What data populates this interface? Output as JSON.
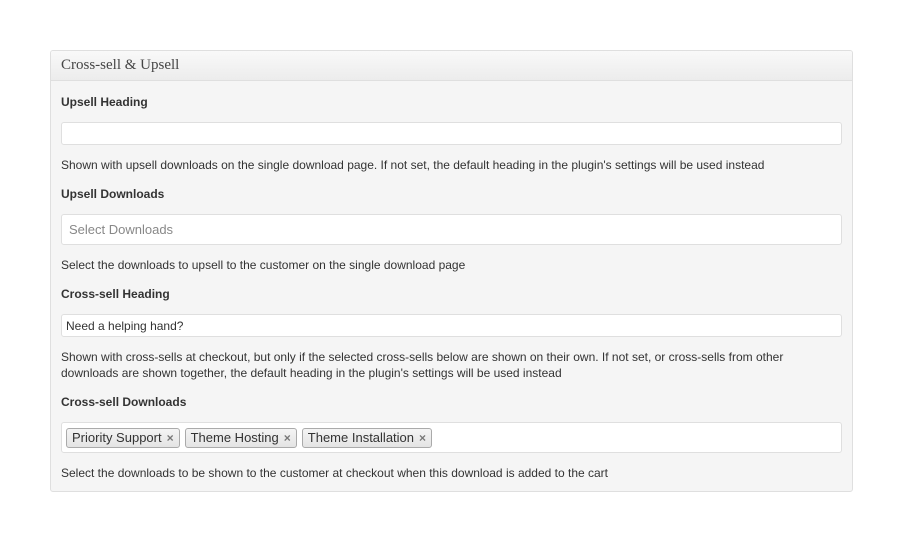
{
  "metabox": {
    "title": "Cross-sell & Upsell"
  },
  "upsell_heading": {
    "label": "Upsell Heading",
    "value": "",
    "description": "Shown with upsell downloads on the single download page. If not set, the default heading in the plugin's settings will be used instead"
  },
  "upsell_downloads": {
    "label": "Upsell Downloads",
    "placeholder": "Select Downloads",
    "description": "Select the downloads to upsell to the customer on the single download page"
  },
  "crosssell_heading": {
    "label": "Cross-sell Heading",
    "value": "Need a helping hand?",
    "description": "Shown with cross-sells at checkout, but only if the selected cross-sells below are shown on their own. If not set, or cross-sells from other downloads are shown together, the default heading in the plugin's settings will be used instead"
  },
  "crosssell_downloads": {
    "label": "Cross-sell Downloads",
    "chips": [
      {
        "label": "Priority Support",
        "remove": "×"
      },
      {
        "label": "Theme Hosting",
        "remove": "×"
      },
      {
        "label": "Theme Installation",
        "remove": "×"
      }
    ],
    "description": "Select the downloads to be shown to the customer at checkout when this download is added to the cart"
  }
}
